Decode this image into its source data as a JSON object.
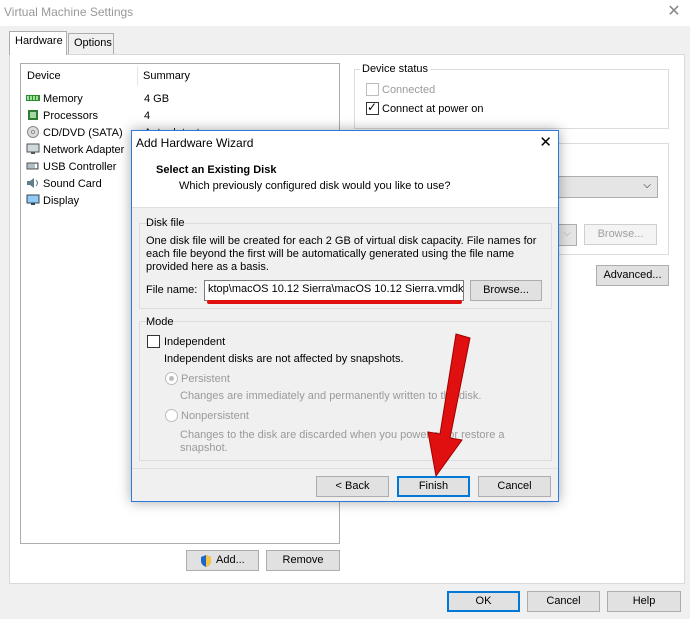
{
  "window": {
    "title": "Virtual Machine Settings"
  },
  "tabs": [
    "Hardware",
    "Options"
  ],
  "device_list": {
    "col_device": "Device",
    "col_summary": "Summary",
    "rows": [
      {
        "name": "Memory",
        "summary": "4 GB",
        "icon": "memory-icon"
      },
      {
        "name": "Processors",
        "summary": "4",
        "icon": "processor-icon"
      },
      {
        "name": "CD/DVD (SATA)",
        "summary": "Auto detect",
        "icon": "cd-dvd-icon"
      },
      {
        "name": "Network Adapter",
        "summary": "",
        "icon": "network-icon"
      },
      {
        "name": "USB Controller",
        "summary": "",
        "icon": "usb-icon"
      },
      {
        "name": "Sound Card",
        "summary": "",
        "icon": "sound-icon"
      },
      {
        "name": "Display",
        "summary": "",
        "icon": "display-icon"
      }
    ]
  },
  "buttons": {
    "add": "Add...",
    "remove": "Remove",
    "ok": "OK",
    "cancel": "Cancel",
    "help": "Help",
    "browse_bg": "Browse...",
    "advanced": "Advanced..."
  },
  "device_status": {
    "label": "Device status",
    "connected": "Connected",
    "connect_power_on": "Connect at power on"
  },
  "dialog": {
    "title": "Add Hardware Wizard",
    "heading": "Select an Existing Disk",
    "subheading": "Which previously configured disk would you like to use?",
    "disk_file_label": "Disk file",
    "disk_file_desc_1": "One disk file will be created for each 2 GB of virtual disk capacity. File names for",
    "disk_file_desc_2": "each file beyond the first will be automatically generated using the file name",
    "disk_file_desc_3": "provided here as a basis.",
    "file_name_label": "File name:",
    "file_name_value": "ktop\\macOS 10.12 Sierra\\macOS 10.12 Sierra.vmdk",
    "browse": "Browse...",
    "mode_label": "Mode",
    "independent": "Independent",
    "independent_desc": "Independent disks are not affected by snapshots.",
    "persistent": "Persistent",
    "persistent_desc": "Changes are immediately and permanently written to the disk.",
    "nonpersistent": "Nonpersistent",
    "nonpersistent_desc_1": "Changes to the disk are discarded when you power off or restore a",
    "nonpersistent_desc_2": "snapshot.",
    "back": "< Back",
    "finish": "Finish",
    "cancel": "Cancel"
  },
  "colors": {
    "accent": "#0078d7",
    "arrow": "#e01010"
  }
}
